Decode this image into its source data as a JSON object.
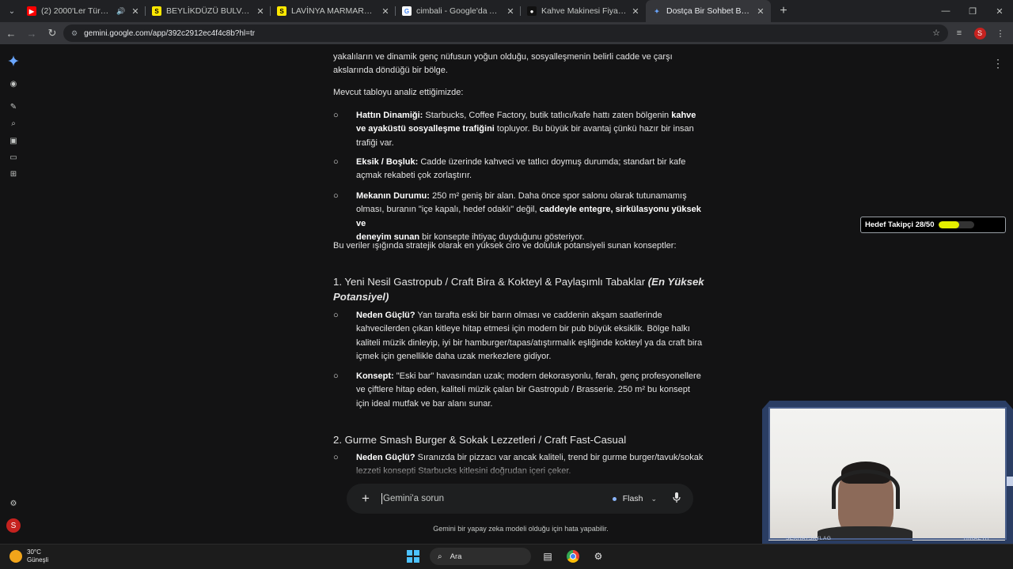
{
  "tabs": [
    {
      "title": "(2) 2000'Ler Türkçe Slow - Y",
      "favicon": "youtube-icon",
      "audio": true,
      "active": false
    },
    {
      "title": "BEYLİKDÜZÜ BULVAR KİRALIK 2",
      "favicon": "sahibinden-icon",
      "active": false
    },
    {
      "title": "LAVİNYA MARMARADA KURUM",
      "favicon": "sahibinden-icon",
      "active": false
    },
    {
      "title": "cimbali - Google'da Ara",
      "favicon": "google-icon",
      "active": false
    },
    {
      "title": "Kahve Makinesi Fiyatları ve En",
      "favicon": "store-icon",
      "active": false
    },
    {
      "title": "Dostça Bir Sohbet Başlangıcı - G",
      "favicon": "gemini-icon",
      "active": true
    }
  ],
  "address_bar": {
    "url": "gemini.google.com/app/392c2912ec4f4c8b?hl=tr"
  },
  "profile_initial": "S",
  "content": {
    "intro_lines": [
      "yakalıların ve dinamik genç nüfusun yoğun olduğu, sosyalleşmenin belirli cadde ve çarşı",
      "akslarında döndüğü bir bölge."
    ],
    "analysis_lead": "Mevcut tabloyu analiz ettiğimizde:",
    "bullets": [
      {
        "lines": [
          [
            {
              "b": "Hattın Dinamiği:"
            },
            {
              "t": " Starbucks, Coffee Factory, butik tatlıcı/kafe hattı zaten bölgenin "
            },
            {
              "b": "kahve"
            }
          ],
          [
            {
              "b": "ve ayaküstü sosyalleşme trafiğini"
            },
            {
              "t": " topluyor. Bu büyük bir avantaj çünkü hazır bir insan"
            }
          ],
          [
            {
              "t": "trafiği var."
            }
          ]
        ]
      },
      {
        "lines": [
          [
            {
              "b": "Eksik / Boşluk:"
            },
            {
              "t": " Cadde üzerinde kahveci ve tatlıcı doymuş durumda; standart bir kafe"
            }
          ],
          [
            {
              "t": "açmak rekabeti çok zorlaştırır."
            }
          ]
        ]
      },
      {
        "lines": [
          [
            {
              "b": "Mekanın Durumu:"
            },
            {
              "t": " 250 m² geniş bir alan. Daha önce spor salonu olarak tutunamamış"
            }
          ],
          [
            {
              "t": "olması, buranın \"içe kapalı, hedef odaklı\" değil, "
            },
            {
              "b": "caddeyle entegre, sirkülasyonu yüksek ve"
            }
          ],
          [
            {
              "b": "deneyim sunan"
            },
            {
              "t": " bir konsepte ihtiyaç duyduğunu gösteriyor."
            }
          ]
        ]
      }
    ],
    "summary": "Bu veriler ışığında stratejik olarak en yüksek ciro ve doluluk potansiyeli sunan konseptler:",
    "concept1": {
      "title": "1. Yeni Nesil Gastropub / Craft Bira & Kokteyl & Paylaşımlı Tabaklar ",
      "title_emph": "(En Yüksek",
      "title_emph2": "Potansiyel)",
      "bullets": [
        {
          "lines": [
            [
              {
                "b": "Neden Güçlü?"
              },
              {
                "t": " Yan tarafta eski bir barın olması ve caddenin akşam saatlerinde"
              }
            ],
            [
              {
                "t": "kahvecilerden çıkan kitleye hitap etmesi için modern bir pub büyük eksiklik. Bölge halkı"
              }
            ],
            [
              {
                "t": "kaliteli müzik dinleyip, iyi bir hamburger/tapas/atıştırmalık eşliğinde kokteyl ya da craft bira"
              }
            ],
            [
              {
                "t": "içmek için genellikle daha uzak merkezlere gidiyor."
              }
            ]
          ]
        },
        {
          "lines": [
            [
              {
                "b": "Konsept:"
              },
              {
                "t": " \"Eski bar\" havasından uzak; modern dekorasyonlu, ferah, genç profesyonellere"
              }
            ],
            [
              {
                "t": "ve çiftlere hitap eden, kaliteli müzik çalan bir Gastropub / Brasserie. 250 m² bu konsept"
              }
            ],
            [
              {
                "t": "için ideal mutfak ve bar alanı sunar."
              }
            ]
          ]
        }
      ]
    },
    "concept2": {
      "title": "2. Gurme Smash Burger & Sokak Lezzetleri / Craft Fast-Casual",
      "bullets": [
        {
          "lines": [
            [
              {
                "b": "Neden Güçlü?"
              },
              {
                "t": " Sıranızda bir pizzacı var ancak kaliteli, trend bir gurme burger/tavuk/sokak"
              }
            ],
            [
              {
                "t": "lezzeti konsepti Starbucks kitlesini doğrudan içeri çeker."
              }
            ]
          ]
        }
      ]
    }
  },
  "input": {
    "placeholder": "Gemini'a sorun",
    "model": "Flash"
  },
  "disclaimer": "Gemini bir yapay zeka modeli olduğu için hata yapabilir.",
  "tracker": {
    "label": "Hedef Takipçi 28/50",
    "current": 28,
    "target": 50,
    "color": "#e5ef00"
  },
  "webcam": {
    "left_tag": "SERHATSAYLAG",
    "right_tag": "HIRAETH"
  },
  "taskbar": {
    "temp": "30°C",
    "condition": "Güneşli",
    "search_label": "Ara"
  }
}
